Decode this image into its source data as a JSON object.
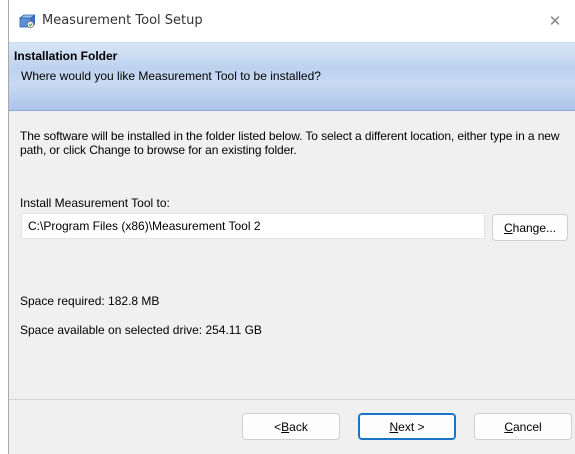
{
  "window": {
    "title": "Measurement Tool Setup",
    "close_glyph": "✕"
  },
  "banner": {
    "title": "Installation Folder",
    "subtitle": "Where would you like Measurement Tool to be installed?"
  },
  "content": {
    "description": "The software will be installed in the folder listed below. To select a different location, either type in a new path, or click Change to browse for an existing folder.",
    "install_label": "Install Measurement Tool to:",
    "install_path": "C:\\Program Files (x86)\\Measurement Tool 2",
    "change_button": {
      "accel": "C",
      "rest": "hange..."
    },
    "space_required": "Space required: 182.8 MB",
    "space_available": "Space available on selected drive: 254.11 GB"
  },
  "footer": {
    "back_button": {
      "prefix": "< ",
      "accel": "B",
      "rest": "ack"
    },
    "next_button": {
      "accel": "N",
      "rest": "ext >"
    },
    "cancel_button": {
      "accel": "C",
      "rest": "ancel"
    }
  },
  "icons": {
    "app": "installer-box-icon",
    "close": "close-icon"
  },
  "colors": {
    "banner_top": "#d7e5f7",
    "banner_bottom": "#aac4e9",
    "default_button_border": "#1a73c7",
    "dialog_background": "#f0f0f0"
  }
}
